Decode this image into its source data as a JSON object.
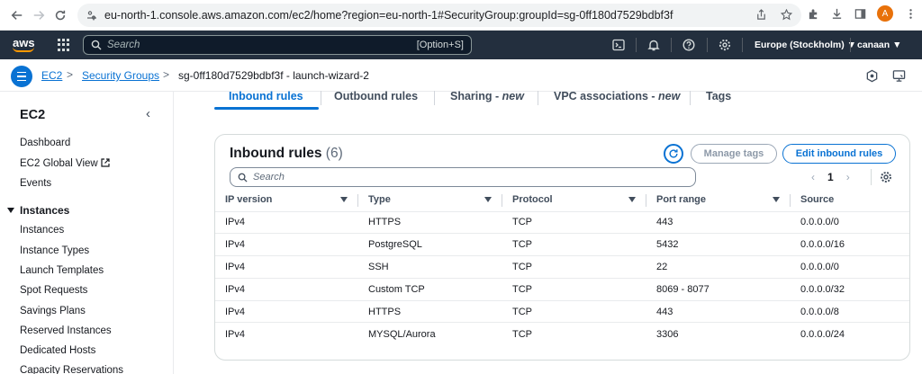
{
  "browser": {
    "url": "eu-north-1.console.aws.amazon.com/ec2/home?region=eu-north-1#SecurityGroup:groupId=sg-0ff180d7529bdbf3f",
    "profile_initial": "A"
  },
  "aws_header": {
    "logo": "aws",
    "search_placeholder": "Search",
    "search_shortcut": "[Option+S]",
    "region": "Europe (Stockholm) ▼",
    "user": "canaan ▼"
  },
  "breadcrumb": {
    "items": [
      "EC2",
      "Security Groups"
    ],
    "current": "sg-0ff180d7529bdbf3f - launch-wizard-2"
  },
  "sidebar": {
    "title": "EC2",
    "items": [
      "Dashboard",
      "EC2 Global View",
      "Events"
    ],
    "section": "Instances",
    "section_items": [
      "Instances",
      "Instance Types",
      "Launch Templates",
      "Spot Requests",
      "Savings Plans",
      "Reserved Instances",
      "Dedicated Hosts",
      "Capacity Reservations"
    ]
  },
  "tabs": [
    {
      "label": "Inbound rules",
      "suffix": ""
    },
    {
      "label": "Outbound rules",
      "suffix": ""
    },
    {
      "label": "Sharing - ",
      "suffix": "new"
    },
    {
      "label": "VPC associations - ",
      "suffix": "new"
    },
    {
      "label": "Tags",
      "suffix": ""
    }
  ],
  "panel": {
    "title": "Inbound rules",
    "count": "(6)",
    "manage_tags": "Manage tags",
    "edit_rules": "Edit inbound rules",
    "search_placeholder": "Search",
    "page": "1"
  },
  "table": {
    "columns": [
      "IP version",
      "Type",
      "Protocol",
      "Port range",
      "Source"
    ],
    "rows": [
      [
        "IPv4",
        "HTTPS",
        "TCP",
        "443",
        "0.0.0.0/0"
      ],
      [
        "IPv4",
        "PostgreSQL",
        "TCP",
        "5432",
        "0.0.0.0/16"
      ],
      [
        "IPv4",
        "SSH",
        "TCP",
        "22",
        "0.0.0.0/0"
      ],
      [
        "IPv4",
        "Custom TCP",
        "TCP",
        "8069 - 8077",
        "0.0.0.0/32"
      ],
      [
        "IPv4",
        "HTTPS",
        "TCP",
        "443",
        "0.0.0.0/8"
      ],
      [
        "IPv4",
        "MYSQL/Aurora",
        "TCP",
        "3306",
        "0.0.0.0/24"
      ]
    ]
  },
  "colors": {
    "aws_nav": "#232f3e",
    "accent": "#0972d3",
    "aws_orange": "#ff9900"
  }
}
